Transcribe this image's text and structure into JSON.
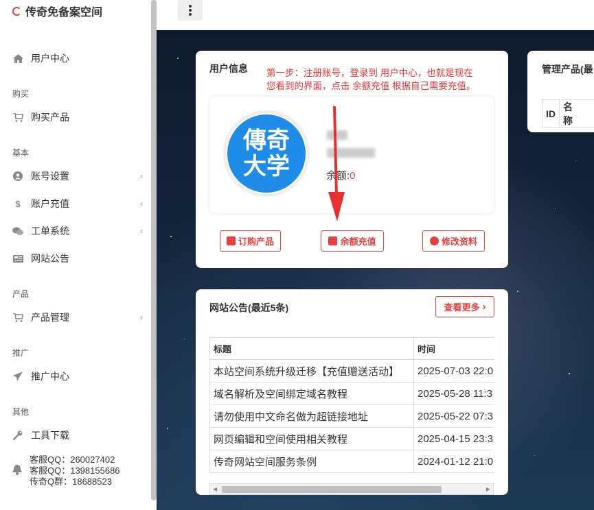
{
  "app": {
    "brand": "传奇免备案空间"
  },
  "sidebar": {
    "user_center": "用户中心",
    "sections": {
      "buy": "购买",
      "basic": "基本",
      "product": "产品",
      "promote": "推广",
      "other": "其他"
    },
    "items": {
      "buy_product": "购买产品",
      "account_settings": "账号设置",
      "recharge": "账户充值",
      "ticket": "工单系统",
      "notice": "网站公告",
      "product_manage": "产品管理",
      "promo_center": "推广中心",
      "tools": "工具下载"
    },
    "contact": {
      "qq1": "客服QQ：260027402",
      "qq2": "客服QQ：1398155686",
      "group": "传奇Q群：18688523"
    }
  },
  "user_info": {
    "title": "用户信息",
    "note_line1": "第一步：注册账号，登录到 用户中心，也就是现在",
    "note_line2": "您看到的界面，点击 余额充值 根据自己需要充值。",
    "avatar_text_top": "傳奇",
    "avatar_text_bottom": "大学",
    "balance_label": "余额:",
    "balance_value": "0",
    "btn_order": "订购产品",
    "btn_recharge": "余额充值",
    "btn_edit": "修改资料"
  },
  "products": {
    "title": "管理产品(最",
    "col_id": "ID",
    "col_name": "名称"
  },
  "notices": {
    "title": "网站公告(最近5条)",
    "more": "查看更多",
    "col_title": "标题",
    "col_time": "时间",
    "rows": [
      {
        "title": "本站空间系统升级迁移【充值赠送活动】",
        "time": "2025-07-03 22:0"
      },
      {
        "title": "域名解析及空间绑定域名教程",
        "time": "2025-05-28 11:3"
      },
      {
        "title": "请勿使用中文命名做为超链接地址",
        "time": "2025-05-22 07:3"
      },
      {
        "title": "网页编辑和空间使用相关教程",
        "time": "2025-04-15 23:3"
      },
      {
        "title": "传奇网站空间服务条例",
        "time": "2024-01-12 21:0"
      }
    ]
  },
  "colors": {
    "accent": "#e64141",
    "avatar_bg": "#1e8ce8"
  }
}
